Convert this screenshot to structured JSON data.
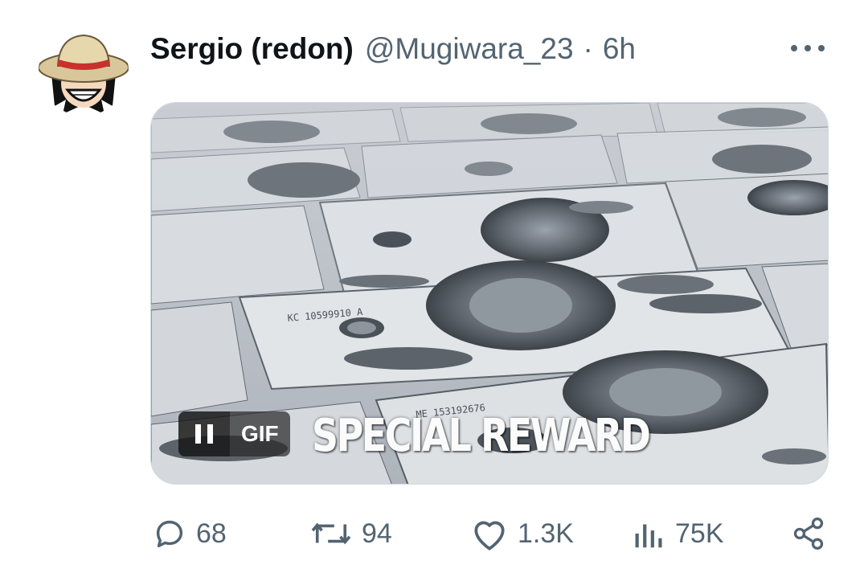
{
  "post": {
    "author_name": "Sergio (redon)",
    "author_handle": "@Mugiwara_23",
    "separator": "·",
    "time_ago": "6h"
  },
  "media": {
    "badge": "GIF",
    "caption": "SPECIAL REWARD",
    "pause_icon": "pause-icon"
  },
  "actions": {
    "replies": "68",
    "reposts": "94",
    "likes": "1.3K",
    "views": "75K",
    "icons": [
      "reply-icon",
      "repost-icon",
      "like-icon",
      "views-icon",
      "share-icon"
    ]
  },
  "colors": {
    "text": "#0f1419",
    "secondary": "#536471",
    "border": "#cfd9de"
  }
}
